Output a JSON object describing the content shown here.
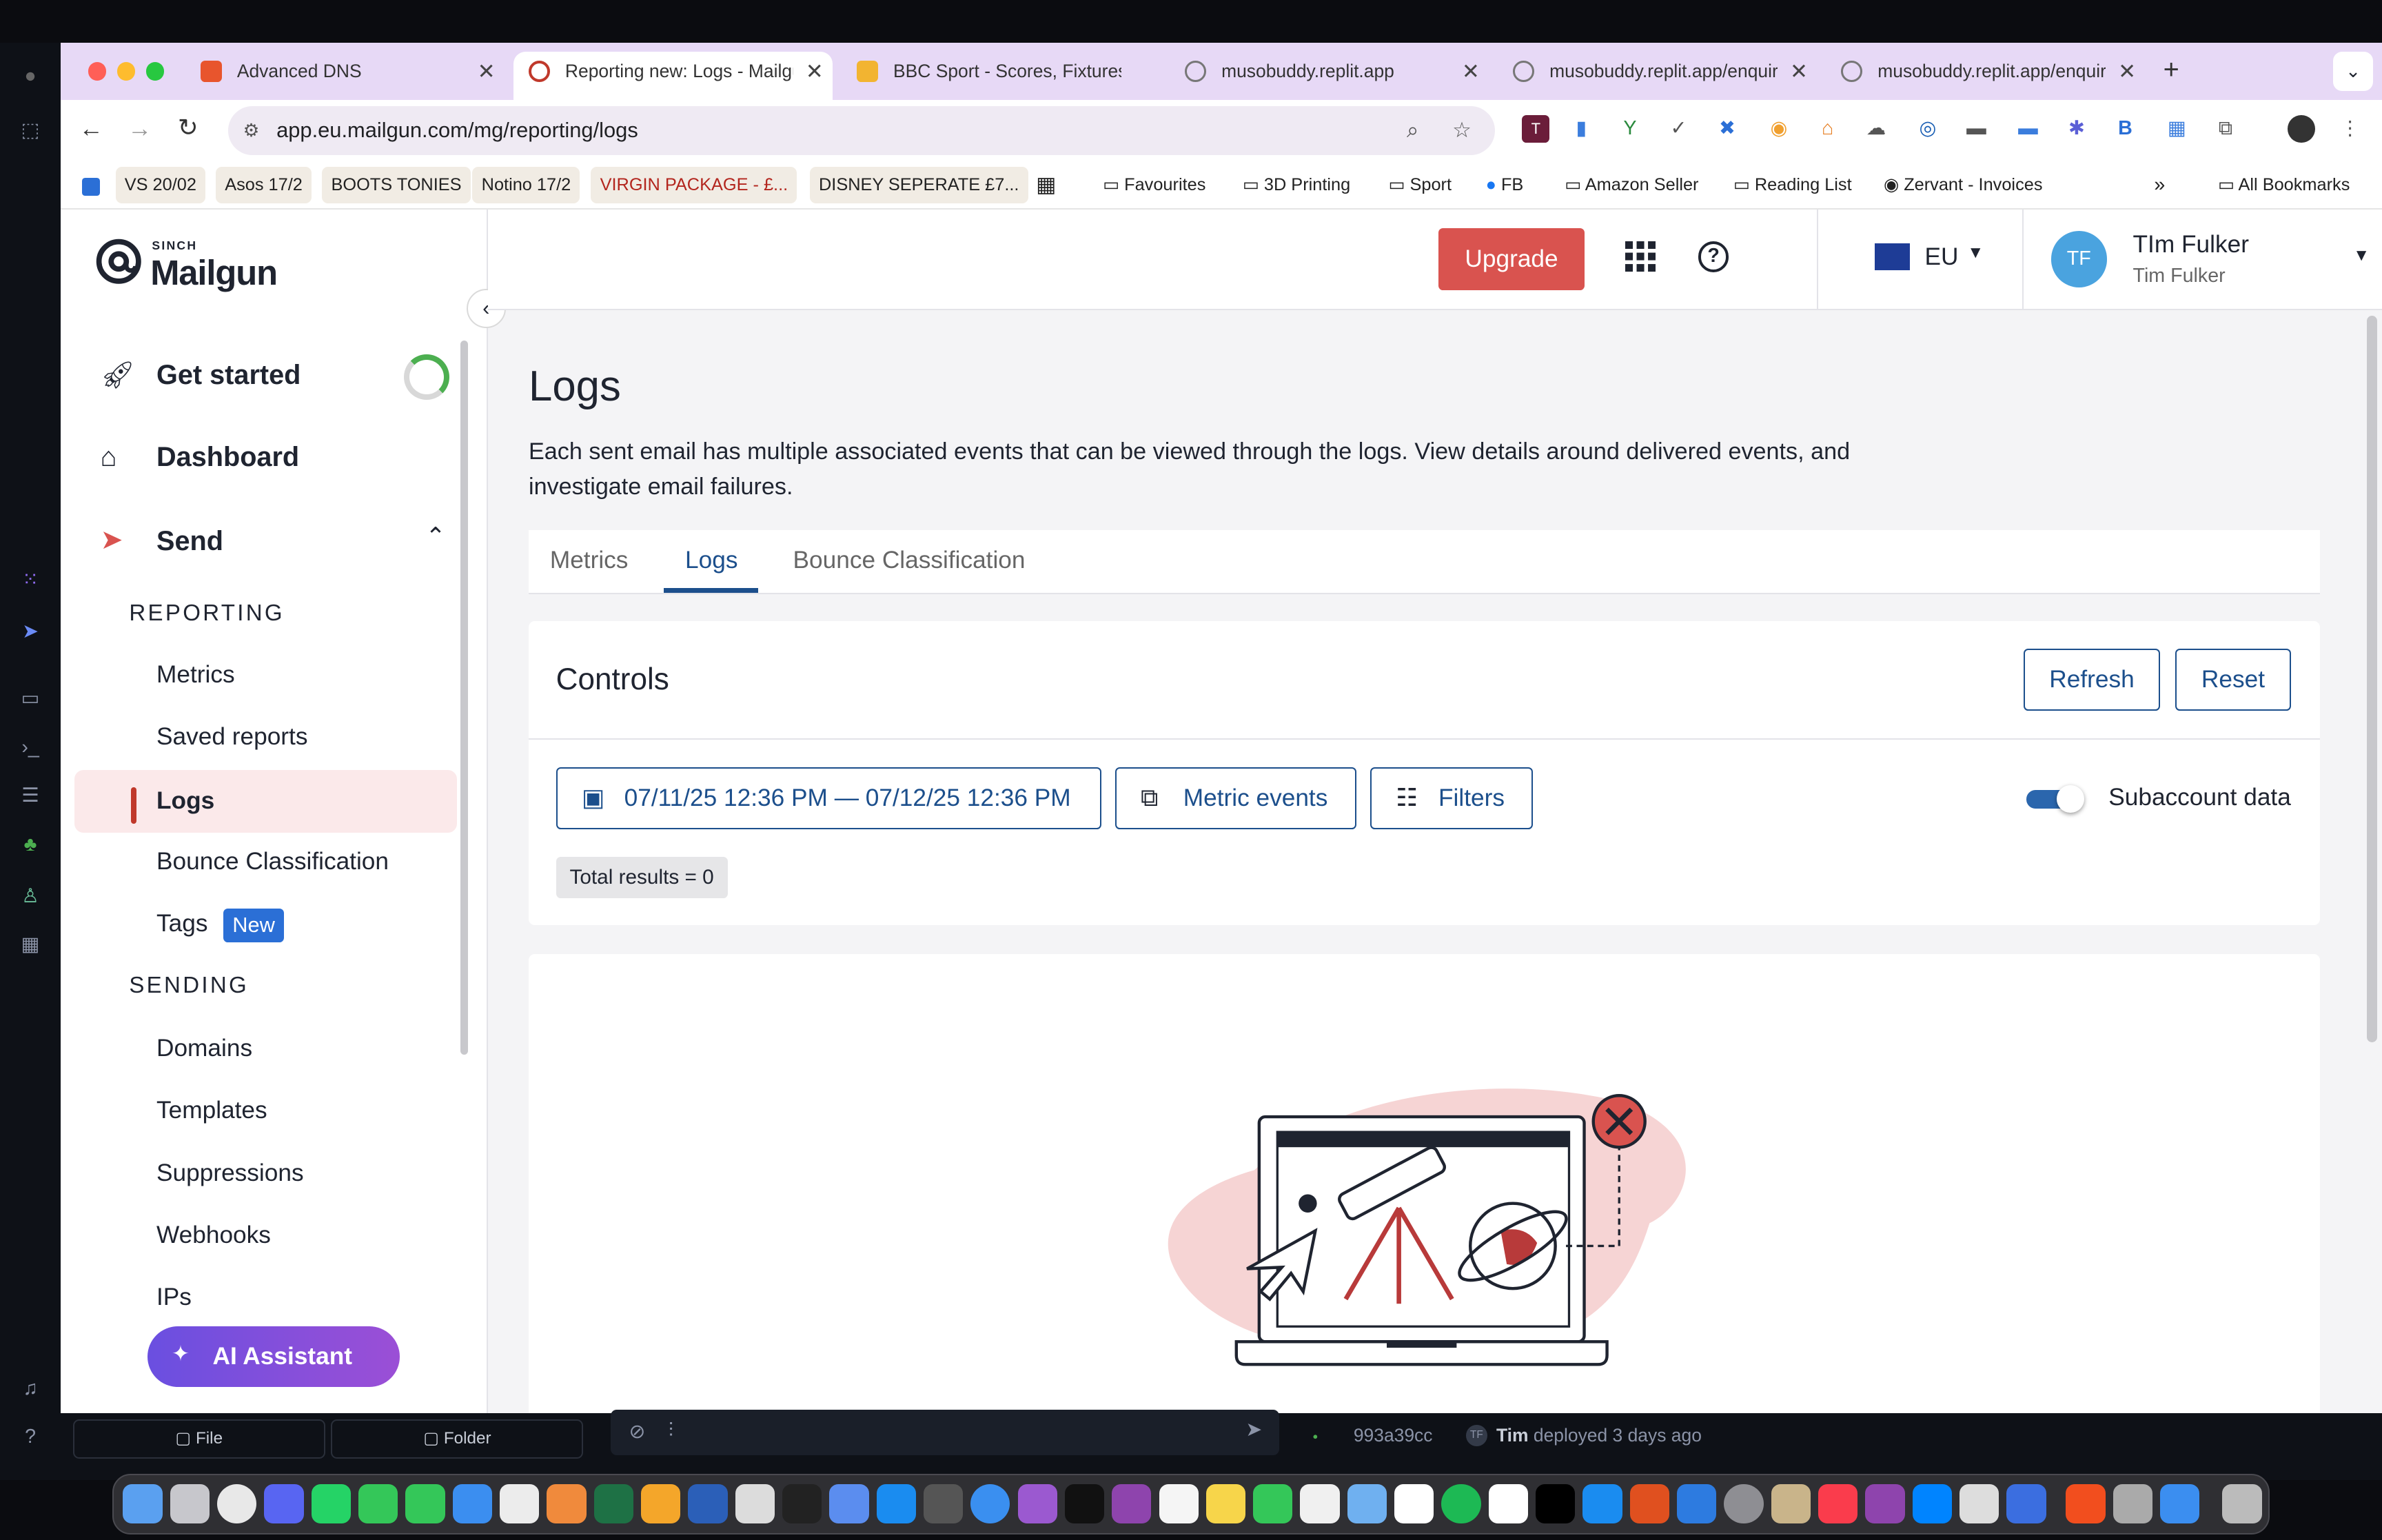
{
  "browser": {
    "tabs": [
      {
        "title": "Advanced DNS",
        "color": "#e8552d"
      },
      {
        "title": "Reporting new: Logs - Mailgu",
        "color": "#c0392b"
      },
      {
        "title": "BBC Sport - Scores, Fixtures,",
        "color": "#f2b431"
      },
      {
        "title": "musobuddy.replit.app",
        "color": "#777"
      },
      {
        "title": "musobuddy.replit.app/enquiri",
        "color": "#777"
      },
      {
        "title": "musobuddy.replit.app/enquiri",
        "color": "#777"
      }
    ],
    "url": "app.eu.mailgun.com/mg/reporting/logs",
    "bookmarks": [
      "VS 20/02",
      "Asos 17/2",
      "BOOTS TONIES",
      "Notino 17/2",
      "VIRGIN PACKAGE - £...",
      "DISNEY SEPERATE £7...",
      "Favourites",
      "3D Printing",
      "Sport",
      "FB",
      "Amazon Seller",
      "Reading List",
      "Zervant - Invoices",
      "All Bookmarks"
    ]
  },
  "header": {
    "logo_small": "SINCH",
    "logo": "Mailgun",
    "upgrade": "Upgrade",
    "region": "EU",
    "avatar_initials": "TF",
    "user_name": "TIm Fulker",
    "user_sub": "Tim Fulker"
  },
  "sidebar": {
    "get_started": "Get started",
    "dashboard": "Dashboard",
    "send": "Send",
    "reporting_label": "REPORTING",
    "reporting": [
      "Metrics",
      "Saved reports",
      "Logs",
      "Bounce Classification",
      "Tags"
    ],
    "tags_badge": "New",
    "sending_label": "SENDING",
    "sending": [
      "Domains",
      "Templates",
      "Suppressions",
      "Webhooks",
      "IPs"
    ],
    "ai_assistant": "AI Assistant"
  },
  "main": {
    "title": "Logs",
    "description": "Each sent email has multiple associated events that can be viewed through the logs. View details around delivered events, and investigate email failures.",
    "tabs": [
      "Metrics",
      "Logs",
      "Bounce Classification"
    ],
    "controls": {
      "title": "Controls",
      "refresh": "Refresh",
      "reset": "Reset",
      "date_range": "07/11/25 12:36 PM — 07/12/25 12:36 PM",
      "metric_events": "Metric events",
      "filters": "Filters",
      "subaccount": "Subaccount data",
      "total": "Total results = 0"
    }
  },
  "replit_bar": {
    "file": "File",
    "folder": "Folder",
    "commit": "993a39cc",
    "deploy_user": "Tim",
    "deploy_text": "deployed 3 days ago"
  },
  "colors": {
    "brand": "#c02b2b",
    "upgrade": "#d9534f",
    "link": "#1c4f8c",
    "ai": "#7c4dde",
    "active_bg": "#fbe9ea"
  }
}
